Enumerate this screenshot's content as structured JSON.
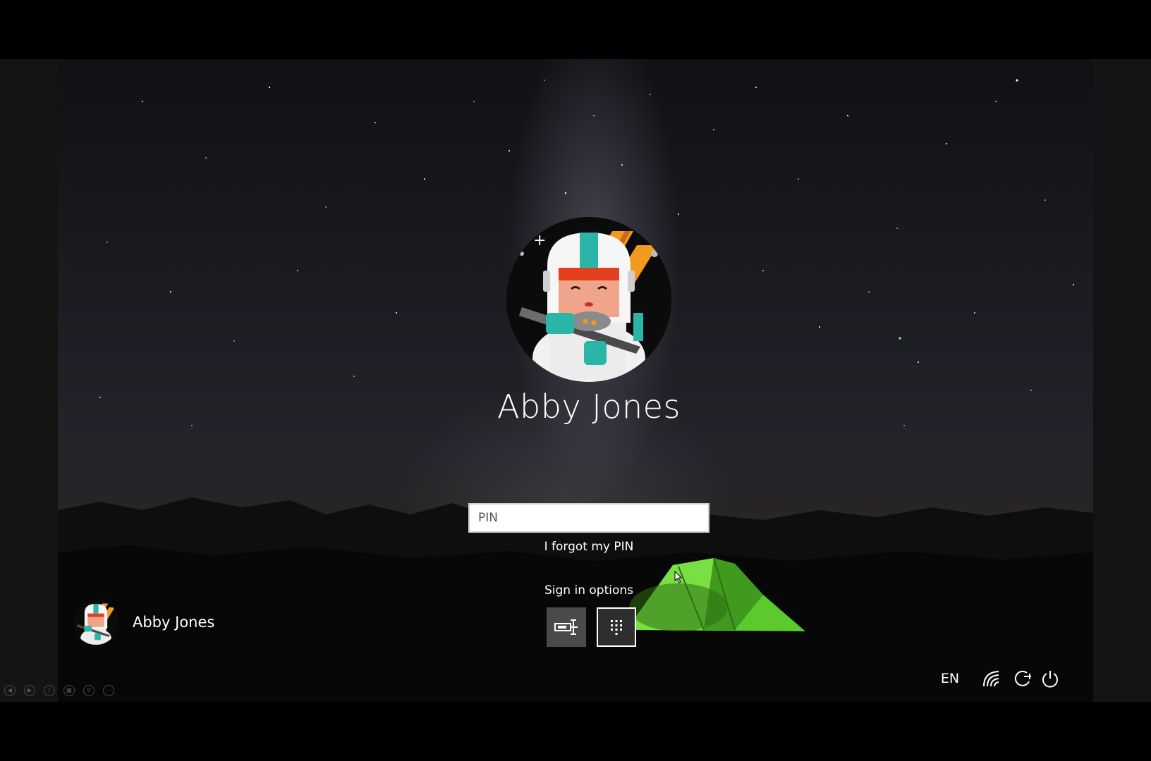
{
  "user": {
    "display_name": "Abby Jones"
  },
  "pin_field": {
    "placeholder": "PIN",
    "value": ""
  },
  "forgot_pin_label": "I forgot my PIN",
  "sign_in_options": {
    "label": "Sign in options",
    "options": [
      {
        "icon": "security-key-icon",
        "selected": false
      },
      {
        "icon": "pin-keypad-icon",
        "selected": true
      }
    ]
  },
  "accounts": [
    {
      "name": "Abby Jones"
    }
  ],
  "tray": {
    "language": "EN",
    "icons": [
      "network-icon",
      "ease-of-access-icon",
      "power-icon"
    ]
  },
  "presenter_toolbar": {
    "icons": [
      "previous-icon",
      "next-icon",
      "pen-icon",
      "slides-icon",
      "zoom-icon",
      "more-icon"
    ]
  },
  "colors": {
    "accent_orange": "#f29a1d",
    "accent_teal": "#2bb5a6",
    "helmet_red": "#e2401e",
    "tent_green": "#6fd63a"
  }
}
